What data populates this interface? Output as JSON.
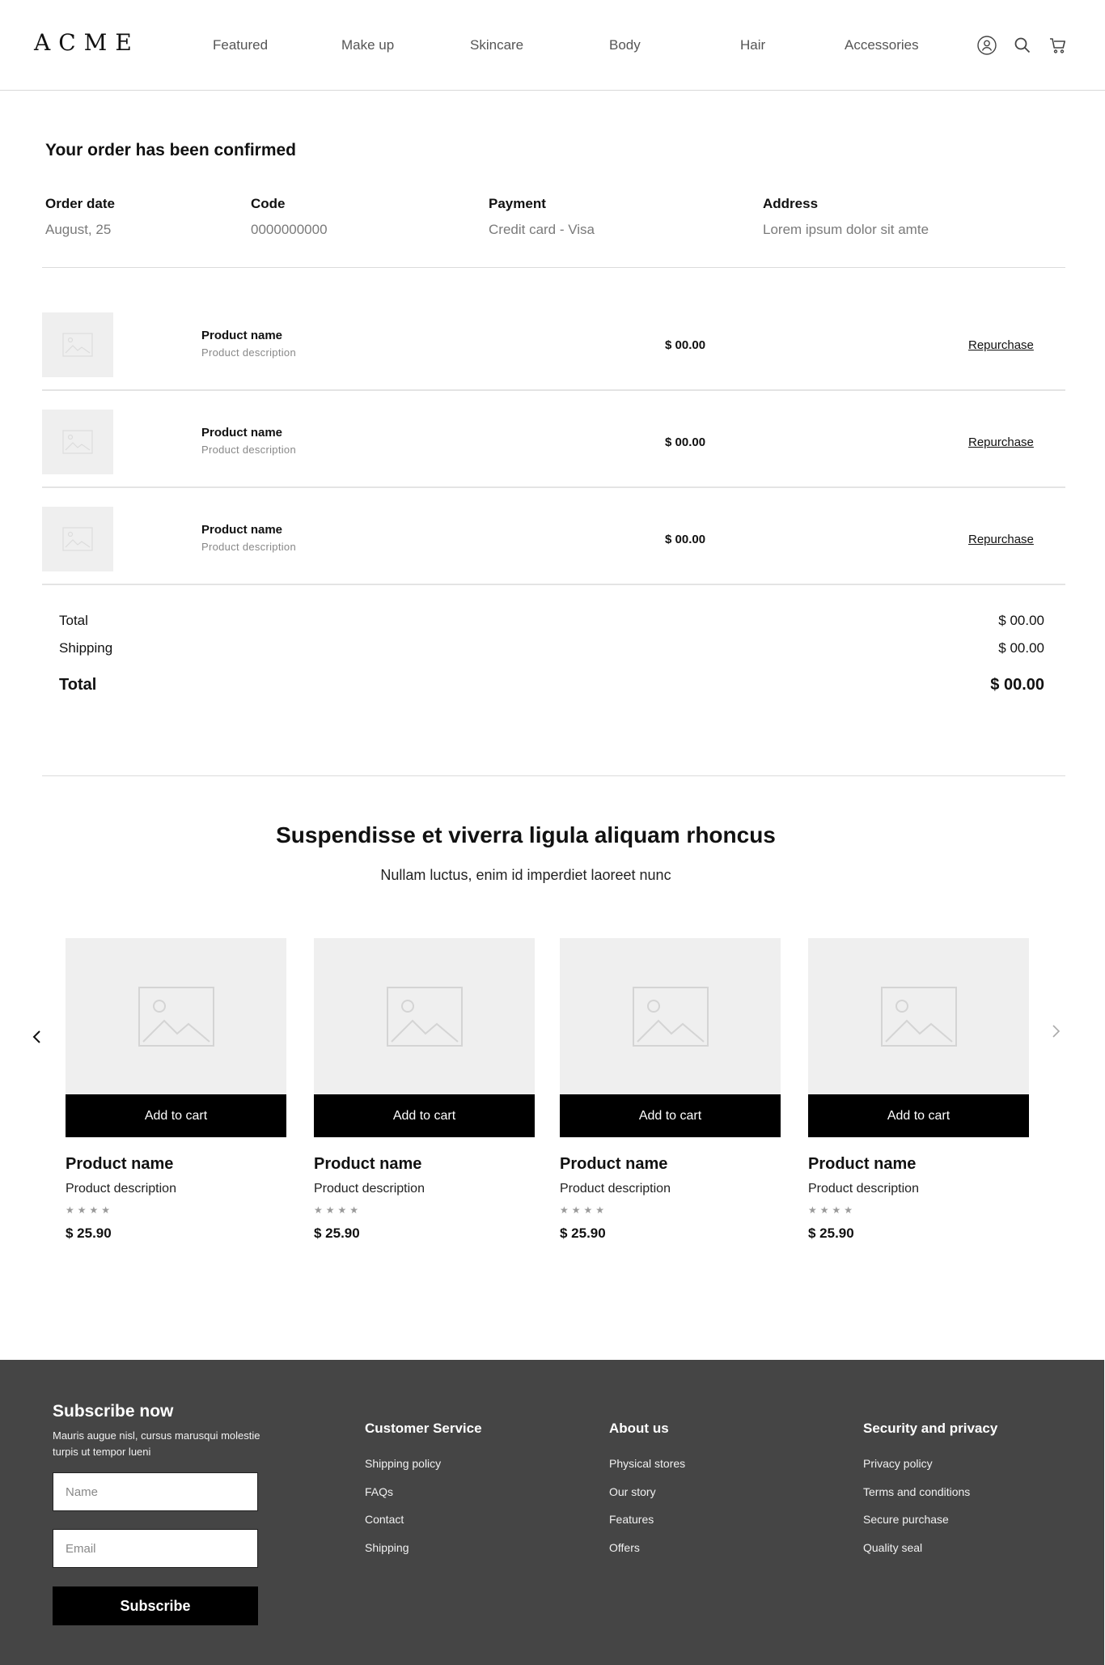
{
  "header": {
    "logo": "ACME",
    "nav": [
      "Featured",
      "Make up",
      "Skincare",
      "Body",
      "Hair",
      "Accessories"
    ]
  },
  "order": {
    "title": "Your order has been confirmed",
    "meta": [
      {
        "label": "Order date",
        "value": "August, 25"
      },
      {
        "label": "Code",
        "value": "0000000000"
      },
      {
        "label": "Payment",
        "value": "Credit card - Visa"
      },
      {
        "label": "Address",
        "value": "Lorem ipsum dolor sit amte"
      }
    ],
    "items": [
      {
        "name": "Product name",
        "description": "Product description",
        "price": "$ 00.00",
        "action": "Repurchase"
      },
      {
        "name": "Product name",
        "description": "Product description",
        "price": "$ 00.00",
        "action": "Repurchase"
      },
      {
        "name": "Product name",
        "description": "Product description",
        "price": "$ 00.00",
        "action": "Repurchase"
      }
    ],
    "totals": {
      "subtotal_label": "Total",
      "subtotal_value": "$ 00.00",
      "shipping_label": "Shipping",
      "shipping_value": "$ 00.00",
      "total_label": "Total",
      "total_value": "$ 00.00"
    }
  },
  "recommendations": {
    "title": "Suspendisse et viverra ligula aliquam rhoncus",
    "subtitle": "Nullam luctus, enim id imperdiet laoreet nunc",
    "products": [
      {
        "button": "Add to cart",
        "name": "Product name",
        "description": "Product description",
        "stars": "★★★★",
        "price": "$ 25.90"
      },
      {
        "button": "Add to cart",
        "name": "Product name",
        "description": "Product description",
        "stars": "★★★★",
        "price": "$ 25.90"
      },
      {
        "button": "Add to cart",
        "name": "Product name",
        "description": "Product description",
        "stars": "★★★★",
        "price": "$ 25.90"
      },
      {
        "button": "Add to cart",
        "name": "Product name",
        "description": "Product description",
        "stars": "★★★★",
        "price": "$ 25.90"
      }
    ]
  },
  "footer": {
    "subscribe": {
      "title": "Subscribe now",
      "text": "Mauris augue nisl, cursus marusqui molestie turpis ut tempor lueni",
      "name_placeholder": "Name",
      "email_placeholder": "Email",
      "button": "Subscribe"
    },
    "columns": [
      {
        "title": "Customer Service",
        "links": [
          "Shipping policy",
          "FAQs",
          "Contact",
          "Shipping"
        ]
      },
      {
        "title": "About us",
        "links": [
          "Physical stores",
          "Our story",
          "Features",
          "Offers"
        ]
      },
      {
        "title": "Security and privacy",
        "links": [
          "Privacy policy",
          "Terms and conditions",
          "Secure purchase",
          "Quality seal"
        ]
      }
    ]
  },
  "colors": {
    "footer_bg": "#454545",
    "button_bg": "#000000",
    "placeholder_bg": "#efefef"
  },
  "icons": [
    "user-icon",
    "search-icon",
    "cart-icon",
    "chevron-left-icon",
    "chevron-right-icon",
    "image-placeholder-icon"
  ]
}
